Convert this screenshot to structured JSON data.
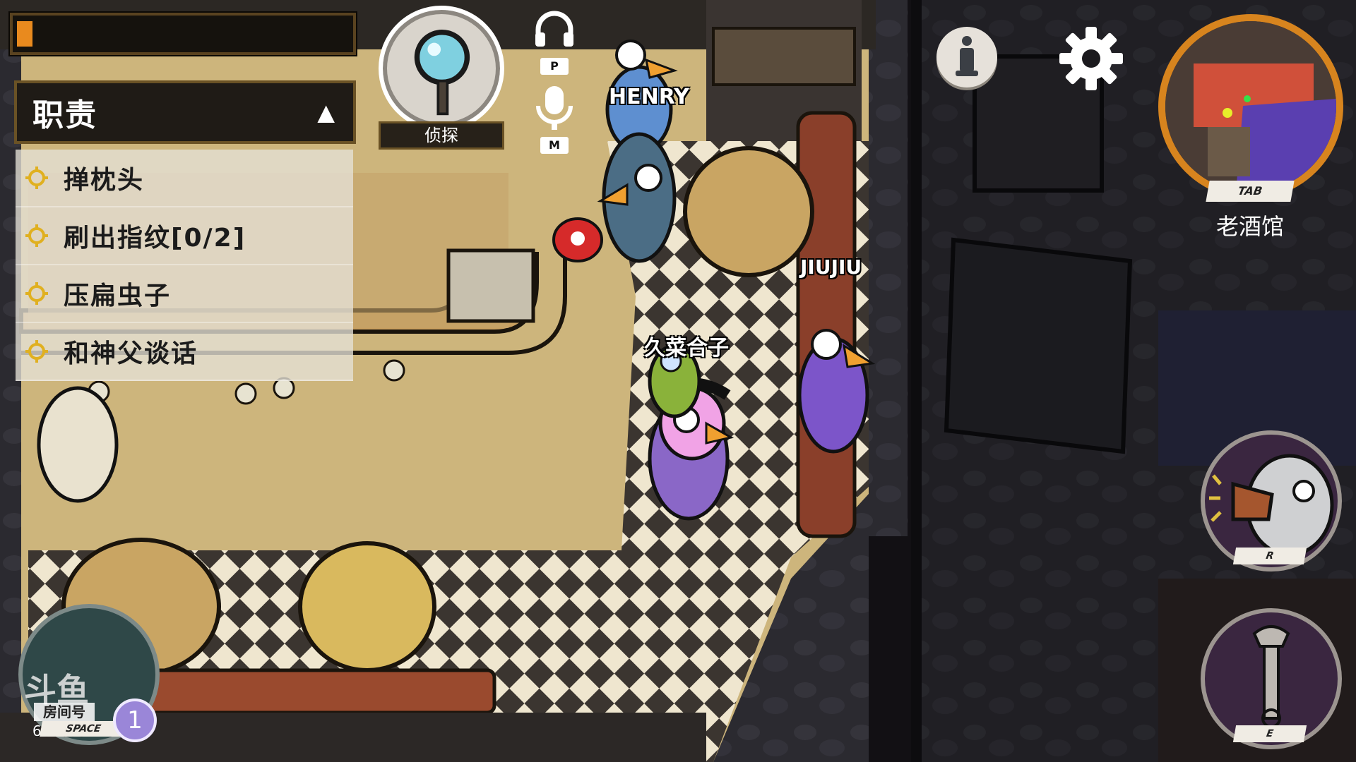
{
  "hud": {
    "progress": 0.03,
    "tasks_title": "职责",
    "collapse_icon": "triangle-up-icon",
    "tasks": [
      {
        "label": "掸枕头",
        "icon": "task-marker-icon"
      },
      {
        "label": "刷出指纹[0/2]",
        "icon": "task-marker-icon"
      },
      {
        "label": "压扁虫子",
        "icon": "task-marker-icon"
      },
      {
        "label": "和神父谈话",
        "icon": "task-marker-icon"
      }
    ],
    "role": {
      "label": "侦探",
      "icon": "magnifier-icon"
    },
    "voice": {
      "push_to_talk_key": "P",
      "mute_key": "M"
    },
    "location": {
      "map_key": "TAB",
      "name": "老酒馆"
    },
    "abilities": [
      {
        "key": "R",
        "icon": "goose-honk-icon"
      },
      {
        "key": "E",
        "icon": "wrench-icon"
      }
    ],
    "bottom_left": {
      "key": "SPACE",
      "count": "1",
      "room_label": "房间号",
      "room_number": "680033",
      "watermark_icon": "douyu-logo"
    }
  },
  "players": [
    {
      "name": "HENRY"
    },
    {
      "name": "JIUJIU"
    },
    {
      "name": "久菜合子"
    }
  ],
  "colors": {
    "progress_fill": "#e98a1e",
    "minimap_ring": "#d7841e",
    "panel_border": "#6a5225",
    "task_marker": "#e0b020"
  }
}
